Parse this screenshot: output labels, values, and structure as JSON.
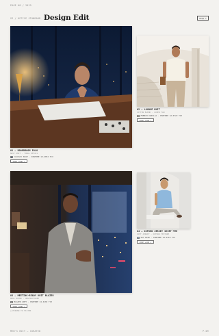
{
  "header": {
    "top_label": "Page 08 / 2025",
    "crumb": "SS / Office Standard",
    "title": "Design Edit",
    "menu_label": "Shop ▸"
  },
  "looks": [
    {
      "name": "01 — Boardroom Polo",
      "meta": "Navy knit · Tonal detail",
      "color_label": "Classic Blue · Pantone 19-4052 TCX",
      "color_hex": "#1f3a6b",
      "button": "Shop Look ▸"
    },
    {
      "name": "02 — Lounge Knit",
      "meta": "Cotton blend · Linen tan",
      "color_label": "French Vanilla · Pantone 12-0722 TCX",
      "color_hex": "#efe3b8",
      "button": "Shop Look ▸"
    },
    {
      "name": "03 — Meeting-Ready Knit Blazer",
      "meta": "Wool blend · Unstructured",
      "color_label": "Blazer Grey · Pantone 14-4102 TCX",
      "color_hex": "#b9b7b1",
      "button": "Shop Look ▸",
      "extra": "□ Expand to filter"
    },
    {
      "name": "04 — Oxford Jersey Shirt-Tee",
      "meta": "Soft jersey · Oxford texture",
      "color_label": "Sky Blue · Pantone 14-4318 TCX",
      "color_hex": "#8fb8dc",
      "button": "Shop Look ▸"
    }
  ],
  "footer": {
    "left": "Men's Edit — Curated",
    "right": "P.09"
  }
}
